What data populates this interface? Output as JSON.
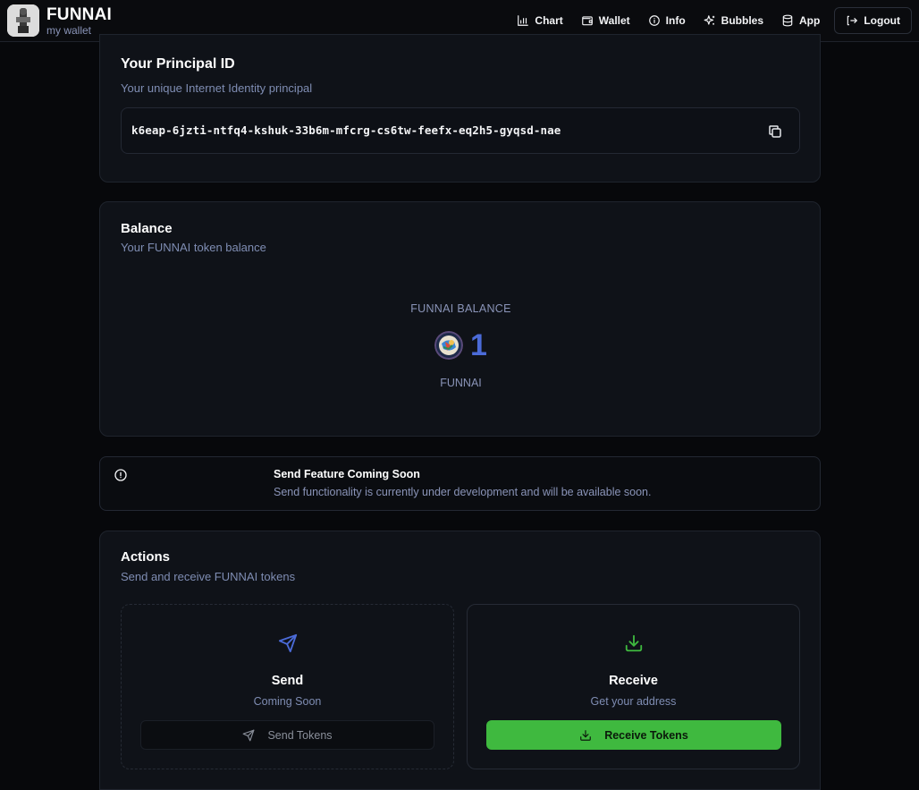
{
  "header": {
    "brand_title": "FUNNAI",
    "brand_subtitle": "my wallet",
    "nav": [
      {
        "label": "Chart",
        "icon": "bar-chart-icon"
      },
      {
        "label": "Wallet",
        "icon": "wallet-icon"
      },
      {
        "label": "Info",
        "icon": "info-icon"
      },
      {
        "label": "Bubbles",
        "icon": "sparkles-icon"
      },
      {
        "label": "App",
        "icon": "database-icon"
      },
      {
        "label": "Logout",
        "icon": "logout-icon"
      }
    ]
  },
  "principal": {
    "title": "Your Principal ID",
    "subtitle": "Your unique Internet Identity principal",
    "value": "k6eap-6jzti-ntfq4-kshuk-33b6m-mfcrg-cs6tw-feefx-eq2h5-gyqsd-nae"
  },
  "balance": {
    "title": "Balance",
    "subtitle": "Your FUNNAI token balance",
    "label": "FUNNAI BALANCE",
    "value": "1",
    "unit": "FUNNAI"
  },
  "notice": {
    "title": "Send Feature Coming Soon",
    "text": "Send functionality is currently under development and will be available soon."
  },
  "actions": {
    "title": "Actions",
    "subtitle": "Send and receive FUNNAI tokens",
    "send": {
      "title": "Send",
      "subtitle": "Coming Soon",
      "button": "Send Tokens"
    },
    "receive": {
      "title": "Receive",
      "subtitle": "Get your address",
      "button": "Receive Tokens"
    }
  },
  "colors": {
    "accent_blue": "#4b6bd8",
    "accent_green": "#3fb93f",
    "background": "#07080b",
    "card": "#0f1218"
  }
}
